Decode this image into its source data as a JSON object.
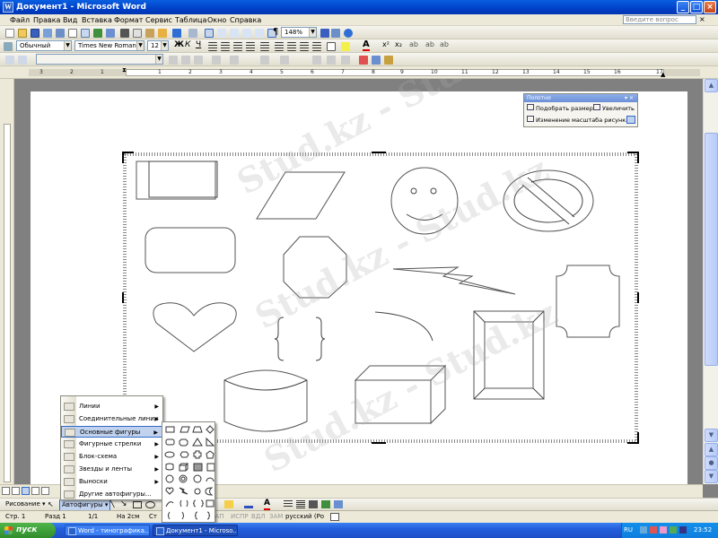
{
  "window": {
    "title": "Документ1 - Microsoft Word",
    "icon": "word-icon"
  },
  "menubar": {
    "items": [
      "Файл",
      "Правка",
      "Вид",
      "Вставка",
      "Формат",
      "Сервис",
      "Таблица",
      "Окно",
      "Справка"
    ],
    "ask_placeholder": "Введите вопрос"
  },
  "formatting": {
    "style": "Обычный",
    "font": "Times New Roman",
    "size": "12",
    "zoom": "148%"
  },
  "ruler": {
    "marks": [
      "3",
      "2",
      "1",
      "1",
      "2",
      "3",
      "4",
      "5",
      "6",
      "7",
      "8",
      "9",
      "10",
      "11",
      "12",
      "13",
      "14",
      "15",
      "16",
      "17"
    ]
  },
  "polotno": {
    "title": "Полотно",
    "fit_label": "Подобрать размер",
    "expand_label": "Увеличить",
    "scale_label": "Изменение масштаба рисунка"
  },
  "autoshapes_menu": {
    "items": [
      {
        "label": "Линии",
        "icon": "lines-icon",
        "submenu": true
      },
      {
        "label": "Соединительные линии",
        "icon": "connectors-icon",
        "submenu": true
      },
      {
        "label": "Основные фигуры",
        "icon": "basic-shapes-icon",
        "submenu": true,
        "selected": true
      },
      {
        "label": "Фигурные стрелки",
        "icon": "block-arrows-icon",
        "submenu": true
      },
      {
        "label": "Блок-схема",
        "icon": "flowchart-icon",
        "submenu": true
      },
      {
        "label": "Звезды и ленты",
        "icon": "stars-icon",
        "submenu": true
      },
      {
        "label": "Выноски",
        "icon": "callouts-icon",
        "submenu": true
      },
      {
        "label": "Другие автофигуры...",
        "icon": "more-shapes-icon",
        "submenu": false
      }
    ]
  },
  "drawbar": {
    "drawing_label": "Рисование",
    "autoshapes_label": "Автофигуры"
  },
  "status": {
    "page": "Стр. 1",
    "section": "Разд 1",
    "pages": "1/1",
    "position": "На 2см",
    "col": "Ст",
    "rec": "ЗАП",
    "trk": "ИСПР",
    "ext": "ВДЛ",
    "ovr": "ЗАМ",
    "lang": "русский (Ро"
  },
  "taskbar": {
    "start_label": "пуск",
    "tasks": [
      "Word - тинографика...",
      "Документ1 - Microso..."
    ],
    "lang": "RU",
    "time": "23:52"
  },
  "watermark": "Stud.kz - Stud.kz",
  "colors": {
    "titlebar": "#0a5fe0",
    "taskbar": "#245edb",
    "start": "#2f8d2b",
    "menu_highlight": "#c1d2ee"
  }
}
